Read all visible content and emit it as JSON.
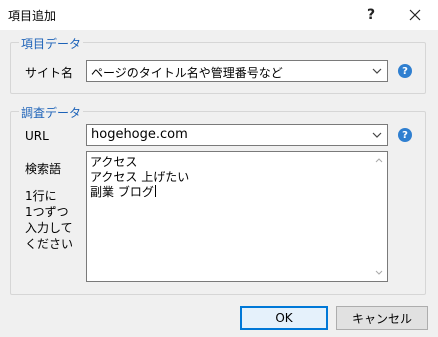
{
  "dialog": {
    "title": "項目追加",
    "help_button": "?",
    "close_icon": "close-icon"
  },
  "item_group": {
    "legend": "項目データ",
    "site_name_label": "サイト名",
    "site_name_value": "ページのタイトル名や管理番号など"
  },
  "research_group": {
    "legend": "調査データ",
    "url_label": "URL",
    "url_value": "hogehoge.com",
    "keyword_label": "検索語",
    "keyword_hint": [
      "1行に",
      "1つずつ",
      "入力して",
      "ください"
    ],
    "keyword_lines": [
      "アクセス",
      "アクセス 上げたい",
      "副業 ブログ"
    ]
  },
  "buttons": {
    "ok": "OK",
    "cancel": "キャンセル"
  },
  "colors": {
    "legend": "#1c62b8",
    "help_icon": "#2f7fd0",
    "default_button_border": "#0078d7"
  }
}
